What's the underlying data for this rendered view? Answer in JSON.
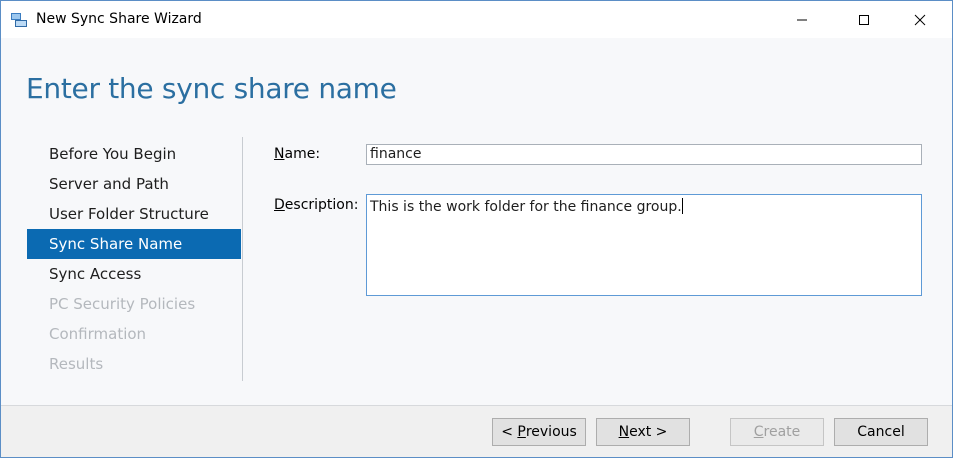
{
  "window": {
    "title": "New Sync Share Wizard"
  },
  "header": {
    "title": "Enter the sync share name"
  },
  "nav": {
    "items": [
      {
        "label": "Before You Begin",
        "state": "normal"
      },
      {
        "label": "Server and Path",
        "state": "normal"
      },
      {
        "label": "User Folder Structure",
        "state": "normal"
      },
      {
        "label": "Sync Share Name",
        "state": "active"
      },
      {
        "label": "Sync Access",
        "state": "normal"
      },
      {
        "label": "PC Security Policies",
        "state": "disabled"
      },
      {
        "label": "Confirmation",
        "state": "disabled"
      },
      {
        "label": "Results",
        "state": "disabled"
      }
    ]
  },
  "form": {
    "name_label_prefix": "",
    "name_label_access": "N",
    "name_label_rest": "ame:",
    "name_value": "finance",
    "description_label_access": "D",
    "description_label_rest": "escription:",
    "description_value": "This is the work folder for the finance group."
  },
  "footer": {
    "previous_prefix": "< ",
    "previous_access": "P",
    "previous_rest": "revious",
    "next_access": "N",
    "next_rest": "ext >",
    "create_access": "C",
    "create_rest": "reate",
    "cancel_label": "Cancel"
  },
  "colors": {
    "accent": "#0b6ab2",
    "title": "#2b6fa1",
    "disabled_text": "#b4b8bd"
  }
}
